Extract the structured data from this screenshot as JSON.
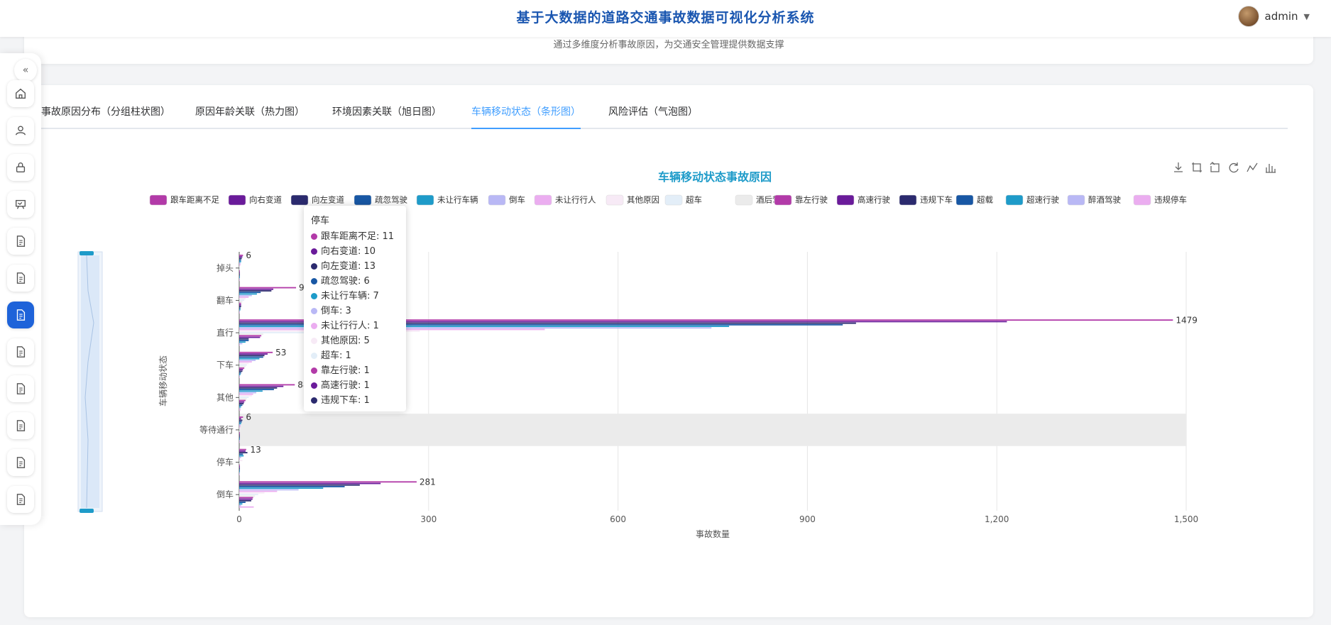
{
  "app": {
    "title": "基于大数据的道路交通事故数据可视化分析系统",
    "user": "admin"
  },
  "banner": {
    "subtitle": "通过多维度分析事故原因，为交通安全管理提供数据支撑"
  },
  "tabs": [
    {
      "label": "事故原因分布（分组柱状图）",
      "active": false
    },
    {
      "label": "原因年龄关联（热力图）",
      "active": false
    },
    {
      "label": "环境因素关联（旭日图）",
      "active": false
    },
    {
      "label": "车辆移动状态（条形图）",
      "active": true
    },
    {
      "label": "风险评估（气泡图）",
      "active": false
    }
  ],
  "sidebar": {
    "icons": [
      "home-icon",
      "user-icon",
      "lock-icon",
      "board-icon",
      "document-icon",
      "document-icon",
      "document-icon",
      "document-icon",
      "document-icon",
      "document-icon",
      "document-icon",
      "document-icon"
    ],
    "active_index": 6
  },
  "toolbox": [
    "download-icon",
    "zoom-icon",
    "zoom-reset-icon",
    "restore-icon",
    "line-switch-icon",
    "bar-switch-icon"
  ],
  "tooltip": {
    "title": "停车",
    "rows": [
      {
        "name": "跟车距离不足",
        "value": 11,
        "color": "#b23aa8"
      },
      {
        "name": "向右变道",
        "value": 10,
        "color": "#6a1b9a"
      },
      {
        "name": "向左变道",
        "value": 13,
        "color": "#2b2a6e"
      },
      {
        "name": "疏忽驾驶",
        "value": 6,
        "color": "#1857a4"
      },
      {
        "name": "未让行车辆",
        "value": 7,
        "color": "#1e9bc9"
      },
      {
        "name": "倒车",
        "value": 3,
        "color": "#b9b8f5"
      },
      {
        "name": "未让行行人",
        "value": 1,
        "color": "#ebadf0"
      },
      {
        "name": "其他原因",
        "value": 5,
        "color": "#f7eaf6"
      },
      {
        "name": "超车",
        "value": 1,
        "color": "#e3eef8"
      },
      {
        "name": "靠左行驶",
        "value": 1,
        "color": "#b23aa8"
      },
      {
        "name": "高速行驶",
        "value": 1,
        "color": "#6a1b9a"
      },
      {
        "name": "违规下车",
        "value": 1,
        "color": "#2b2a6e"
      }
    ]
  },
  "chart_data": {
    "type": "bar",
    "orientation": "horizontal",
    "title": "车辆移动状态事故原因",
    "xlabel": "事故数量",
    "ylabel": "车辆移动状态",
    "xlim": [
      0,
      1500
    ],
    "xticks": [
      0,
      300,
      600,
      900,
      1200,
      1500
    ],
    "xtick_labels": [
      "0",
      "300",
      "600",
      "900",
      "1,200",
      "1,500"
    ],
    "categories": [
      "倒车",
      "停车",
      "等待通行",
      "其他",
      "下车",
      "直行",
      "翻车",
      "掉头"
    ],
    "legend_position": "top",
    "highlighted_category": "等待通行",
    "series": [
      {
        "name": "跟车距离不足",
        "color": "#b23aa8",
        "values": [
          281,
          11,
          6,
          88,
          53,
          1479,
          90,
          6
        ]
      },
      {
        "name": "向右变道",
        "color": "#6a1b9a",
        "values": [
          224,
          10,
          3,
          70,
          45,
          1216,
          54,
          5
        ]
      },
      {
        "name": "向左变道",
        "color": "#2b2a6e",
        "values": [
          191,
          13,
          5,
          60,
          40,
          977,
          51,
          4
        ]
      },
      {
        "name": "疏忽驾驶",
        "color": "#1857a4",
        "values": [
          167,
          6,
          4,
          55,
          38,
          956,
          34,
          3
        ]
      },
      {
        "name": "未让行车辆",
        "color": "#1e9bc9",
        "values": [
          133,
          7,
          3,
          37,
          32,
          776,
          28,
          3
        ]
      },
      {
        "name": "倒车",
        "color": "#b9b8f5",
        "values": [
          94,
          3,
          2,
          27,
          26,
          748,
          20,
          2
        ]
      },
      {
        "name": "未让行行人",
        "color": "#ebadf0",
        "values": [
          60,
          1,
          2,
          22,
          20,
          484,
          15,
          2
        ]
      },
      {
        "name": "其他原因",
        "color": "#f7eaf6",
        "values": [
          40,
          5,
          2,
          20,
          15,
          286,
          10,
          1
        ]
      },
      {
        "name": "超车",
        "color": "#e3eef8",
        "values": [
          30,
          1,
          1,
          15,
          12,
          264,
          8,
          1
        ]
      },
      {
        "name": "酒后驾驶",
        "color": "#ebebeb",
        "values": [
          25,
          1,
          1,
          12,
          10,
          38,
          5,
          1
        ]
      },
      {
        "name": "靠左行驶",
        "color": "#b23aa8",
        "values": [
          22,
          1,
          1,
          10,
          8,
          35,
          3,
          1
        ]
      },
      {
        "name": "高速行驶",
        "color": "#6a1b9a",
        "values": [
          21,
          1,
          1,
          8,
          6,
          33,
          3,
          1
        ]
      },
      {
        "name": "违规下车",
        "color": "#2b2a6e",
        "values": [
          19,
          1,
          1,
          7,
          5,
          15,
          3,
          1
        ]
      },
      {
        "name": "超载",
        "color": "#1857a4",
        "values": [
          10,
          1,
          1,
          5,
          3,
          15,
          2,
          1
        ]
      },
      {
        "name": "超速行驶",
        "color": "#1e9bc9",
        "values": [
          5,
          1,
          1,
          3,
          2,
          10,
          2,
          1
        ]
      },
      {
        "name": "醉酒驾驶",
        "color": "#b9b8f5",
        "values": [
          3,
          1,
          1,
          2,
          1,
          5,
          1,
          1
        ]
      },
      {
        "name": "违规停车",
        "color": "#ebadf0",
        "values": [
          23,
          1,
          1,
          2,
          1,
          1,
          1,
          1
        ]
      }
    ]
  }
}
